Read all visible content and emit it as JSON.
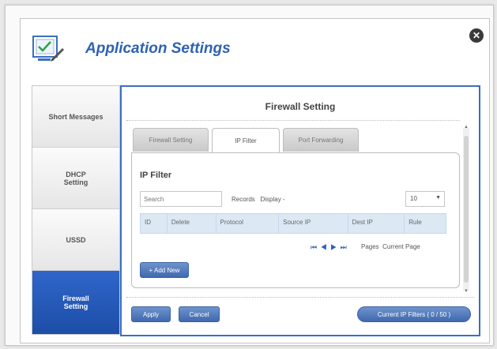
{
  "header": {
    "title": "Application Settings",
    "app_icon": "checklist-icon",
    "close_icon": "close-icon",
    "close_glyph": "✕"
  },
  "sidebar": {
    "items": [
      {
        "label": "Short Messages",
        "active": false
      },
      {
        "label": "DHCP\nSetting",
        "active": false
      },
      {
        "label": "USSD",
        "active": false
      },
      {
        "label": "Firewall\nSetting",
        "active": true
      }
    ]
  },
  "main": {
    "title": "Firewall Setting",
    "tabs": [
      {
        "label": "Firewall Setting",
        "active": false
      },
      {
        "label": "IP Filter",
        "active": true
      },
      {
        "label": "Port Forwarding",
        "active": false
      }
    ],
    "panel": {
      "title": "IP Filter",
      "search_placeholder": "Search",
      "records_label": "Records",
      "display_label": "Display -",
      "display_value": "10",
      "columns": [
        "ID",
        "Delete",
        "Protocol",
        "Source IP",
        "Dest IP",
        "Rule"
      ],
      "pager_glyphs": "⏮ ◀ ▶ ⏭",
      "pages_label": "Pages",
      "current_page_label": "Current Page",
      "add_button": "+ Add New"
    },
    "footer": {
      "apply_button": "Apply",
      "cancel_button": "Cancel",
      "current_filters_button": "Current IP Filters ( 0 / 50 )"
    }
  },
  "colors": {
    "accent": "#2e62b0",
    "active_tab_bg": "#1d4ea8",
    "button": "#4f77b9"
  }
}
